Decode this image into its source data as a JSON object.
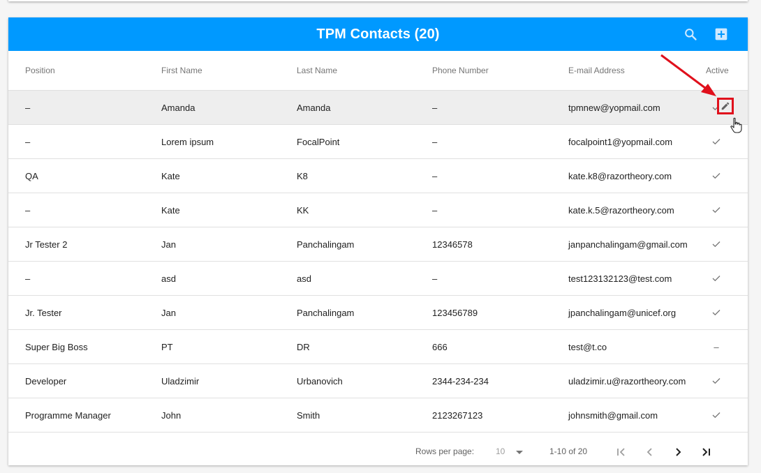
{
  "header": {
    "title": "TPM Contacts (20)"
  },
  "columns": [
    "Position",
    "First Name",
    "Last Name",
    "Phone Number",
    "E-mail Address",
    "Active"
  ],
  "rows": [
    {
      "position": "–",
      "first": "Amanda",
      "last": "Amanda",
      "phone": "–",
      "email": "tpmnew@yopmail.com",
      "active": true
    },
    {
      "position": "–",
      "first": "Lorem ipsum",
      "last": "FocalPoint",
      "phone": "–",
      "email": "focalpoint1@yopmail.com",
      "active": true
    },
    {
      "position": "QA",
      "first": "Kate",
      "last": "K8",
      "phone": "–",
      "email": "kate.k8@razortheory.com",
      "active": true
    },
    {
      "position": "–",
      "first": "Kate",
      "last": "KK",
      "phone": "–",
      "email": "kate.k.5@razortheory.com",
      "active": true
    },
    {
      "position": "Jr Tester 2",
      "first": "Jan",
      "last": "Panchalingam",
      "phone": "12346578",
      "email": "janpanchalingam@gmail.com",
      "active": true
    },
    {
      "position": "–",
      "first": "asd",
      "last": "asd",
      "phone": "–",
      "email": "test123132123@test.com",
      "active": true
    },
    {
      "position": "Jr. Tester",
      "first": "Jan",
      "last": "Panchalingam",
      "phone": "123456789",
      "email": "jpanchalingam@unicef.org",
      "active": true
    },
    {
      "position": "Super Big Boss",
      "first": "PT",
      "last": "DR",
      "phone": "666",
      "email": "test@t.co",
      "active": false
    },
    {
      "position": "Developer",
      "first": "Uladzimir",
      "last": "Urbanovich",
      "phone": "2344-234-234",
      "email": "uladzimir.u@razortheory.com",
      "active": true
    },
    {
      "position": "Programme Manager",
      "first": "John",
      "last": "Smith",
      "phone": "2123267123",
      "email": "johnsmith@gmail.com",
      "active": true
    }
  ],
  "inactive_symbol": "–",
  "footer": {
    "rows_per_page_label": "Rows per page:",
    "rows_per_page_value": "10",
    "range": "1-10 of 20"
  },
  "icons": {
    "search": "search-icon",
    "add": "add-box-icon",
    "edit": "pencil-icon",
    "check": "check-icon",
    "first": "first-page-icon",
    "prev": "chevron-left-icon",
    "next": "chevron-right-icon",
    "last": "last-page-icon"
  },
  "colors": {
    "header": "#0099ff",
    "highlight": "#e0101c",
    "row_hover": "#eeeeee"
  }
}
